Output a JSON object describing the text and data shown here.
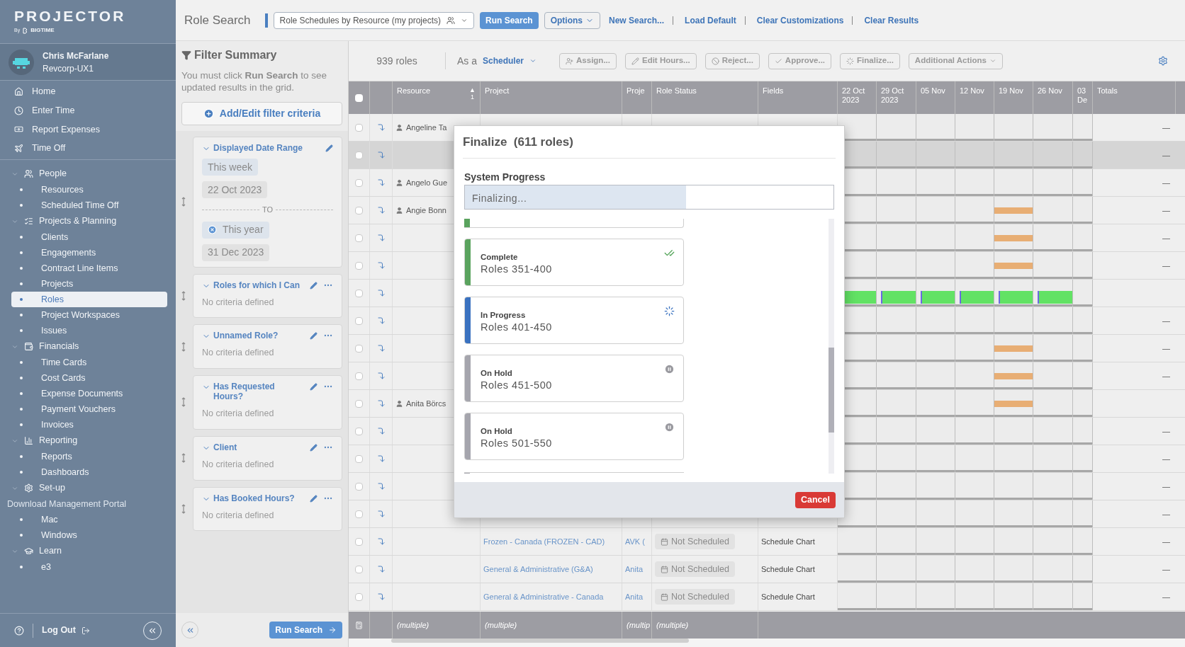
{
  "sidebar": {
    "logo": {
      "title": "PROJECTOR",
      "by": "By",
      "brand": "BIGTIME"
    },
    "user": {
      "name": "Chris McFarlane",
      "org": "Revcorp-UX1"
    },
    "quick_links": [
      {
        "label": "Home"
      },
      {
        "label": "Enter Time"
      },
      {
        "label": "Report Expenses"
      },
      {
        "label": "Time Off"
      }
    ],
    "tree": [
      {
        "label": "People",
        "expanded": true,
        "children": [
          {
            "kind": "link",
            "label": "Resources",
            "selected": false
          },
          {
            "kind": "link",
            "label": "Scheduled Time Off",
            "selected": false
          }
        ]
      },
      {
        "label": "Projects & Planning",
        "expanded": true,
        "children": [
          {
            "kind": "link",
            "label": "Clients",
            "selected": false
          },
          {
            "kind": "link",
            "label": "Engagements",
            "selected": false
          },
          {
            "kind": "link",
            "label": "Contract Line Items",
            "selected": false
          },
          {
            "kind": "link",
            "label": "Projects",
            "selected": false
          },
          {
            "kind": "link",
            "label": "Roles",
            "selected": true
          },
          {
            "kind": "link",
            "label": "Project Workspaces",
            "selected": false
          },
          {
            "kind": "link",
            "label": "Issues",
            "selected": false
          }
        ]
      },
      {
        "label": "Financials",
        "expanded": true,
        "children": [
          {
            "kind": "link",
            "label": "Time Cards",
            "selected": false
          },
          {
            "kind": "link",
            "label": "Cost Cards",
            "selected": false
          },
          {
            "kind": "link",
            "label": "Expense Documents",
            "selected": false
          },
          {
            "kind": "link",
            "label": "Payment Vouchers",
            "selected": false
          },
          {
            "kind": "link",
            "label": "Invoices",
            "selected": false
          }
        ]
      },
      {
        "label": "Reporting",
        "expanded": true,
        "children": [
          {
            "kind": "link",
            "label": "Reports",
            "selected": false
          },
          {
            "kind": "link",
            "label": "Dashboards",
            "selected": false
          }
        ]
      },
      {
        "label": "Set-up",
        "expanded": true,
        "children": [
          {
            "kind": "label",
            "label": "Download Management Portal",
            "selected": false
          },
          {
            "kind": "link",
            "label": "Mac",
            "selected": false
          },
          {
            "kind": "link",
            "label": "Windows",
            "selected": false
          }
        ]
      },
      {
        "label": "Learn",
        "expanded": true,
        "children": [
          {
            "kind": "link",
            "label": "e3",
            "selected": false
          }
        ]
      }
    ],
    "footer": {
      "logout": "Log Out"
    }
  },
  "top_bar": {
    "title": "Role Search",
    "view": "Role Schedules by Resource (my projects)",
    "run": "Run Search",
    "options": "Options",
    "links": [
      "New Search...",
      "Load Default",
      "Clear Customizations",
      "Clear Results"
    ]
  },
  "filter_panel": {
    "title": "Filter Summary",
    "note": "You must click **Run Search** to see updated results in the grid.",
    "add": "Add/Edit filter criteria",
    "criteria": [
      {
        "title": "Displayed Date Range",
        "expanded": true,
        "kind": "date_range",
        "menu": false,
        "chips": [
          {
            "text": "This week",
            "kind": "relative",
            "removable": false
          },
          {
            "text": "22 Oct 2023",
            "kind": "date",
            "removable": false
          }
        ],
        "separator": "TO",
        "end_chips": [
          {
            "text": "This year",
            "kind": "relative",
            "removable": true
          },
          {
            "text": "31 Dec 2023",
            "kind": "date",
            "removable": false
          }
        ]
      },
      {
        "title": "Roles for which I Can",
        "expanded": true,
        "kind": "empty",
        "menu": true,
        "note": "No criteria defined"
      },
      {
        "title": "Unnamed Role?",
        "expanded": true,
        "kind": "empty",
        "menu": true,
        "note": "No criteria defined"
      },
      {
        "title": "Has Requested Hours?",
        "expanded": true,
        "kind": "empty",
        "menu": true,
        "note": "No criteria defined"
      },
      {
        "title": "Client",
        "expanded": true,
        "kind": "empty",
        "menu": true,
        "note": "No criteria defined"
      },
      {
        "title": "Has Booked Hours?",
        "expanded": true,
        "kind": "empty",
        "menu": true,
        "note": "No criteria defined"
      }
    ],
    "run": "Run Search"
  },
  "grid": {
    "toolbar": {
      "count": "939 roles",
      "as": "As a",
      "role": "Scheduler",
      "actions": [
        {
          "label": "Assign...",
          "disabled": true,
          "kind": "button"
        },
        {
          "label": "Edit Hours...",
          "disabled": true,
          "kind": "button"
        },
        {
          "label": "Reject...",
          "disabled": true,
          "kind": "button"
        },
        {
          "label": "Approve...",
          "disabled": true,
          "kind": "button"
        },
        {
          "label": "Finalize...",
          "disabled": true,
          "kind": "button"
        },
        {
          "label": "Additional Actions",
          "disabled": true,
          "kind": "menu"
        }
      ]
    },
    "all_selected": false,
    "columns": [
      {
        "label": "Resource",
        "sort_arrow": "▲",
        "sort_index": "1"
      },
      {
        "label": "Project"
      },
      {
        "label": "Proje"
      },
      {
        "label": "Role Status"
      },
      {
        "label": "Fields"
      },
      {
        "label": "22 Oct 2023"
      },
      {
        "label": "29 Oct 2023"
      },
      {
        "label": "05 Nov"
      },
      {
        "label": "12 Nov"
      },
      {
        "label": "19 Nov"
      },
      {
        "label": "26 Nov"
      },
      {
        "label": "03 De"
      },
      {
        "label": "Totals"
      }
    ],
    "rows": [
      {
        "resource": "Angeline Ta",
        "selected": false,
        "total": "—"
      },
      {
        "selected": true,
        "total": "—"
      },
      {
        "resource": "Angelo Gue",
        "selected": false,
        "total": "—"
      },
      {
        "resource": "Angie Bonn",
        "selected": false,
        "total": "—"
      },
      {
        "selected": false,
        "total": "—"
      },
      {
        "selected": false,
        "total": "—"
      },
      {
        "selected": false
      },
      {
        "selected": false,
        "total": "—"
      },
      {
        "selected": false,
        "total": "—"
      },
      {
        "selected": false,
        "total": "—"
      },
      {
        "resource": "Anita Börcs",
        "selected": false
      },
      {
        "selected": false,
        "total": "—"
      },
      {
        "selected": false,
        "total": "—"
      },
      {
        "selected": false,
        "total": "—"
      },
      {
        "selected": false,
        "total": "—"
      },
      {
        "selected": false,
        "project": "Frozen - Canada (FROZEN - CAD)",
        "proje": "AVK (",
        "status": "Not Scheduled",
        "fields": "Schedule Chart",
        "total": "—"
      },
      {
        "selected": false,
        "project": "General & Administrative (G&A)",
        "proje": "Anita",
        "status": "Not Scheduled",
        "fields": "Schedule Chart",
        "total": "—"
      },
      {
        "selected": false,
        "project": "General & Administrative - Canada",
        "proje": "Anita",
        "status": "Not Scheduled",
        "fields": "Schedule Chart",
        "total": "—"
      }
    ],
    "footer": [
      "(multiple)",
      "(multiple)",
      "(multip",
      "(multiple)"
    ]
  },
  "dialog": {
    "title": "Finalize  (611 roles)",
    "progress_label": "System Progress",
    "progress": {
      "text": "Finalizing...",
      "level": 0.6
    },
    "batches": [
      {
        "kind": "complete",
        "cut": true
      },
      {
        "kind": "complete",
        "cut": false,
        "status": "Complete",
        "roles": "Roles 351-400"
      },
      {
        "kind": "in_progress",
        "cut": false,
        "status": "In Progress",
        "roles": "Roles 401-450"
      },
      {
        "kind": "on_hold",
        "cut": false,
        "status": "On Hold",
        "roles": "Roles 451-500"
      },
      {
        "kind": "on_hold",
        "cut": false,
        "status": "On Hold",
        "roles": "Roles 501-550"
      },
      {
        "kind": "on_hold",
        "cut": true
      }
    ],
    "cancel": "Cancel"
  }
}
